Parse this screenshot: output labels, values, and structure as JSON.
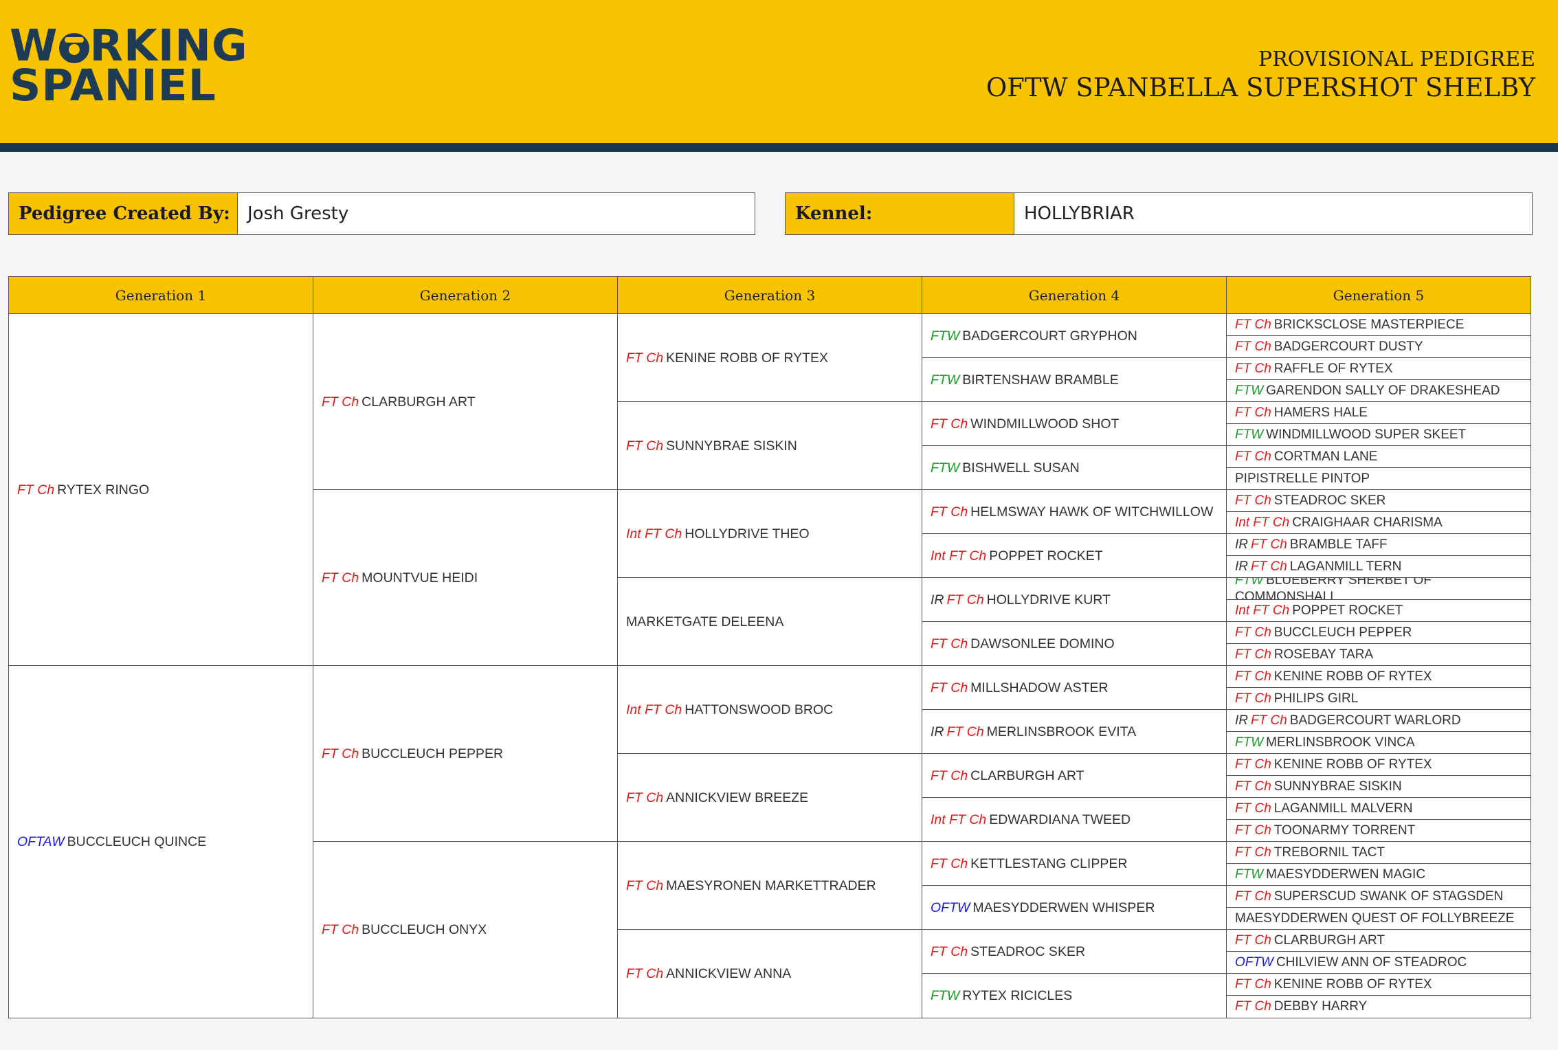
{
  "header": {
    "logo_line1_a": "W",
    "logo_line1_b": "RKING",
    "logo_line2": "SPANIEL",
    "subtitle": "PROVISIONAL PEDIGREE",
    "dog_name": "OFTW SPANBELLA SUPERSHOT SHELBY"
  },
  "info": {
    "created_by_label": "Pedigree Created By:",
    "created_by_value": "Josh Gresty",
    "kennel_label": "Kennel:",
    "kennel_value": "HOLLYBRIAR"
  },
  "colors": {
    "accent": "#f9c302",
    "navy": "#1c3550",
    "title_red": "#e01b1b",
    "title_green": "#1b9a2a",
    "title_blue": "#1a1ae0"
  },
  "columns": [
    "Generation 1",
    "Generation 2",
    "Generation 3",
    "Generation 4",
    "Generation 5"
  ],
  "gen1": [
    {
      "titles": [
        {
          "text": "FT Ch",
          "kind": "ftch"
        }
      ],
      "name": "RYTEX RINGO"
    },
    {
      "titles": [
        {
          "text": "OFTAW",
          "kind": "oftw"
        }
      ],
      "name": "BUCCLEUCH QUINCE"
    }
  ],
  "gen2": [
    {
      "titles": [
        {
          "text": "FT Ch",
          "kind": "ftch"
        }
      ],
      "name": "CLARBURGH ART"
    },
    {
      "titles": [
        {
          "text": "FT Ch",
          "kind": "ftch"
        }
      ],
      "name": "MOUNTVUE HEIDI"
    },
    {
      "titles": [
        {
          "text": "FT Ch",
          "kind": "ftch"
        }
      ],
      "name": "BUCCLEUCH PEPPER"
    },
    {
      "titles": [
        {
          "text": "FT Ch",
          "kind": "ftch"
        }
      ],
      "name": "BUCCLEUCH ONYX"
    }
  ],
  "gen3": [
    {
      "titles": [
        {
          "text": "FT Ch",
          "kind": "ftch"
        }
      ],
      "name": "KENINE ROBB OF RYTEX"
    },
    {
      "titles": [
        {
          "text": "FT Ch",
          "kind": "ftch"
        }
      ],
      "name": "SUNNYBRAE SISKIN"
    },
    {
      "titles": [
        {
          "text": "Int FT Ch",
          "kind": "ftch"
        }
      ],
      "name": "HOLLYDRIVE THEO"
    },
    {
      "titles": [],
      "name": "MARKETGATE DELEENA"
    },
    {
      "titles": [
        {
          "text": "Int FT Ch",
          "kind": "ftch"
        }
      ],
      "name": "HATTONSWOOD BROC"
    },
    {
      "titles": [
        {
          "text": "FT Ch",
          "kind": "ftch"
        }
      ],
      "name": "ANNICKVIEW BREEZE"
    },
    {
      "titles": [
        {
          "text": "FT Ch",
          "kind": "ftch"
        }
      ],
      "name": "MAESYRONEN MARKETTRADER"
    },
    {
      "titles": [
        {
          "text": "FT Ch",
          "kind": "ftch"
        }
      ],
      "name": "ANNICKVIEW ANNA"
    }
  ],
  "gen4": [
    {
      "titles": [
        {
          "text": "FTW",
          "kind": "ftw"
        }
      ],
      "name": "BADGERCOURT GRYPHON"
    },
    {
      "titles": [
        {
          "text": "FTW",
          "kind": "ftw"
        }
      ],
      "name": "BIRTENSHAW BRAMBLE"
    },
    {
      "titles": [
        {
          "text": "FT Ch",
          "kind": "ftch"
        }
      ],
      "name": "WINDMILLWOOD SHOT"
    },
    {
      "titles": [
        {
          "text": "FTW",
          "kind": "ftw"
        }
      ],
      "name": "BISHWELL SUSAN"
    },
    {
      "titles": [
        {
          "text": "FT Ch",
          "kind": "ftch"
        }
      ],
      "name": "HELMSWAY HAWK OF WITCHWILLOW"
    },
    {
      "titles": [
        {
          "text": "Int FT Ch",
          "kind": "ftch"
        }
      ],
      "name": "POPPET ROCKET"
    },
    {
      "titles": [
        {
          "text": "IR",
          "kind": "ir"
        },
        {
          "text": "FT Ch",
          "kind": "ftch"
        }
      ],
      "name": "HOLLYDRIVE KURT"
    },
    {
      "titles": [
        {
          "text": "FT Ch",
          "kind": "ftch"
        }
      ],
      "name": "DAWSONLEE DOMINO"
    },
    {
      "titles": [
        {
          "text": "FT Ch",
          "kind": "ftch"
        }
      ],
      "name": "MILLSHADOW ASTER"
    },
    {
      "titles": [
        {
          "text": "IR",
          "kind": "ir"
        },
        {
          "text": "FT Ch",
          "kind": "ftch"
        }
      ],
      "name": "MERLINSBROOK EVITA"
    },
    {
      "titles": [
        {
          "text": "FT Ch",
          "kind": "ftch"
        }
      ],
      "name": "CLARBURGH ART"
    },
    {
      "titles": [
        {
          "text": "Int FT Ch",
          "kind": "ftch"
        }
      ],
      "name": "EDWARDIANA TWEED"
    },
    {
      "titles": [
        {
          "text": "FT Ch",
          "kind": "ftch"
        }
      ],
      "name": "KETTLESTANG CLIPPER"
    },
    {
      "titles": [
        {
          "text": "OFTW",
          "kind": "oftw"
        }
      ],
      "name": "MAESYDDERWEN WHISPER"
    },
    {
      "titles": [
        {
          "text": "FT Ch",
          "kind": "ftch"
        }
      ],
      "name": "STEADROC SKER"
    },
    {
      "titles": [
        {
          "text": "FTW",
          "kind": "ftw"
        }
      ],
      "name": "RYTEX RICICLES"
    }
  ],
  "gen5": [
    {
      "titles": [
        {
          "text": "FT Ch",
          "kind": "ftch"
        }
      ],
      "name": "BRICKSCLOSE MASTERPIECE"
    },
    {
      "titles": [
        {
          "text": "FT Ch",
          "kind": "ftch"
        }
      ],
      "name": "BADGERCOURT DUSTY"
    },
    {
      "titles": [
        {
          "text": "FT Ch",
          "kind": "ftch"
        }
      ],
      "name": "RAFFLE OF RYTEX"
    },
    {
      "titles": [
        {
          "text": "FTW",
          "kind": "ftw"
        }
      ],
      "name": "GARENDON SALLY OF DRAKESHEAD"
    },
    {
      "titles": [
        {
          "text": "FT Ch",
          "kind": "ftch"
        }
      ],
      "name": "HAMERS HALE"
    },
    {
      "titles": [
        {
          "text": "FTW",
          "kind": "ftw"
        }
      ],
      "name": "WINDMILLWOOD SUPER SKEET"
    },
    {
      "titles": [
        {
          "text": "FT Ch",
          "kind": "ftch"
        }
      ],
      "name": "CORTMAN LANE"
    },
    {
      "titles": [],
      "name": "PIPISTRELLE PINTOP"
    },
    {
      "titles": [
        {
          "text": "FT Ch",
          "kind": "ftch"
        }
      ],
      "name": "STEADROC SKER"
    },
    {
      "titles": [
        {
          "text": "Int FT Ch",
          "kind": "ftch"
        }
      ],
      "name": "CRAIGHAAR CHARISMA"
    },
    {
      "titles": [
        {
          "text": "IR",
          "kind": "ir"
        },
        {
          "text": "FT Ch",
          "kind": "ftch"
        }
      ],
      "name": "BRAMBLE TAFF"
    },
    {
      "titles": [
        {
          "text": "IR",
          "kind": "ir"
        },
        {
          "text": "FT Ch",
          "kind": "ftch"
        }
      ],
      "name": "LAGANMILL TERN"
    },
    {
      "titles": [
        {
          "text": "FTW",
          "kind": "ftw"
        }
      ],
      "name": "BLUEBERRY SHERBET OF COMMONSHALL"
    },
    {
      "titles": [
        {
          "text": "Int FT Ch",
          "kind": "ftch"
        }
      ],
      "name": "POPPET ROCKET"
    },
    {
      "titles": [
        {
          "text": "FT Ch",
          "kind": "ftch"
        }
      ],
      "name": "BUCCLEUCH PEPPER"
    },
    {
      "titles": [
        {
          "text": "FT Ch",
          "kind": "ftch"
        }
      ],
      "name": "ROSEBAY TARA"
    },
    {
      "titles": [
        {
          "text": "FT Ch",
          "kind": "ftch"
        }
      ],
      "name": "KENINE ROBB OF RYTEX"
    },
    {
      "titles": [
        {
          "text": "FT Ch",
          "kind": "ftch"
        }
      ],
      "name": "PHILIPS GIRL"
    },
    {
      "titles": [
        {
          "text": "IR",
          "kind": "ir"
        },
        {
          "text": "FT Ch",
          "kind": "ftch"
        }
      ],
      "name": "BADGERCOURT WARLORD"
    },
    {
      "titles": [
        {
          "text": "FTW",
          "kind": "ftw"
        }
      ],
      "name": "MERLINSBROOK VINCA"
    },
    {
      "titles": [
        {
          "text": "FT Ch",
          "kind": "ftch"
        }
      ],
      "name": "KENINE ROBB OF RYTEX"
    },
    {
      "titles": [
        {
          "text": "FT Ch",
          "kind": "ftch"
        }
      ],
      "name": "SUNNYBRAE SISKIN"
    },
    {
      "titles": [
        {
          "text": "FT Ch",
          "kind": "ftch"
        }
      ],
      "name": "LAGANMILL MALVERN"
    },
    {
      "titles": [
        {
          "text": "FT Ch",
          "kind": "ftch"
        }
      ],
      "name": "TOONARMY TORRENT"
    },
    {
      "titles": [
        {
          "text": "FT Ch",
          "kind": "ftch"
        }
      ],
      "name": "TREBORNIL TACT"
    },
    {
      "titles": [
        {
          "text": "FTW",
          "kind": "ftw"
        }
      ],
      "name": "MAESYDDERWEN MAGIC"
    },
    {
      "titles": [
        {
          "text": "FT Ch",
          "kind": "ftch"
        }
      ],
      "name": "SUPERSCUD SWANK OF STAGSDEN"
    },
    {
      "titles": [],
      "name": "MAESYDDERWEN QUEST OF FOLLYBREEZE"
    },
    {
      "titles": [
        {
          "text": "FT Ch",
          "kind": "ftch"
        }
      ],
      "name": "CLARBURGH ART"
    },
    {
      "titles": [
        {
          "text": "OFTW",
          "kind": "oftw"
        }
      ],
      "name": "CHILVIEW ANN OF STEADROC"
    },
    {
      "titles": [
        {
          "text": "FT Ch",
          "kind": "ftch"
        }
      ],
      "name": "KENINE ROBB OF RYTEX"
    },
    {
      "titles": [
        {
          "text": "FT Ch",
          "kind": "ftch"
        }
      ],
      "name": "DEBBY HARRY"
    }
  ]
}
